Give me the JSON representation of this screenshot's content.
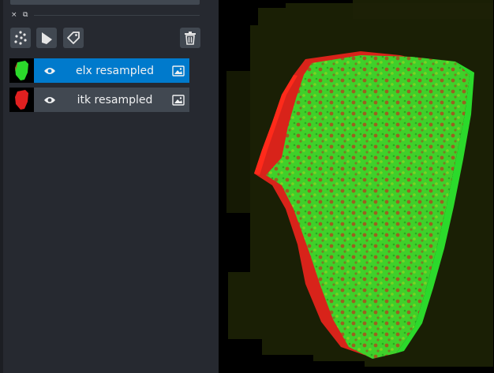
{
  "panel": {
    "close_glyph": "×",
    "float_glyph": "⧉",
    "tools": [
      {
        "name": "points-icon"
      },
      {
        "name": "shapes-icon"
      },
      {
        "name": "labels-icon"
      }
    ],
    "delete_icon": "trash-icon"
  },
  "layers": [
    {
      "name": "elx resampled",
      "selected": true,
      "visible": true,
      "thumb_color": "#2bd92b"
    },
    {
      "name": "itk resampled",
      "selected": false,
      "visible": true,
      "thumb_color": "#e02020"
    }
  ],
  "colors": {
    "accent": "#007acc",
    "panel_bg": "#262930",
    "button_bg": "#414851",
    "tissue_green": "#43d62a",
    "tissue_red": "#e0201a",
    "background_tile": "#1a1f05"
  }
}
